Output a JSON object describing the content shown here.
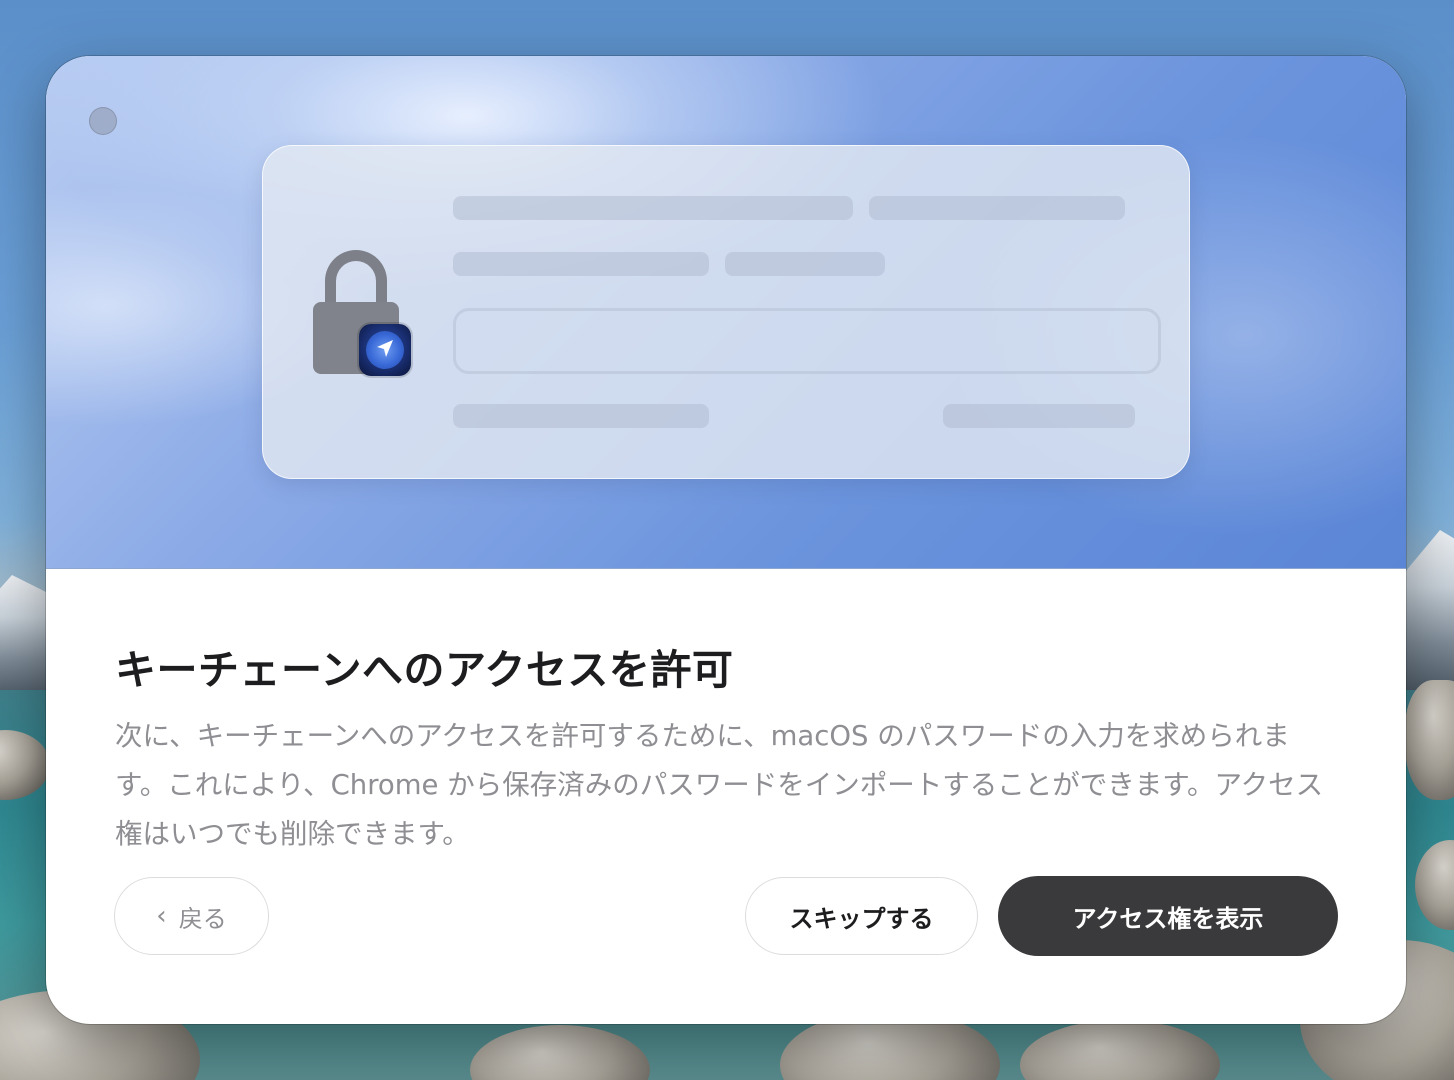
{
  "dialog": {
    "title": "キーチェーンへのアクセスを許可",
    "description": "次に、キーチェーンへのアクセスを許可するために、macOS のパスワードの入力を求められます。これにより、Chrome から保存済みのパスワードをインポートすることができます。アクセス権はいつでも削除できます。",
    "buttons": {
      "back_label": "戻る",
      "skip_label": "スキップする",
      "primary_label": "アクセス権を表示"
    }
  },
  "icons": {
    "window_close": "close-dot-icon",
    "lock": "lock-icon",
    "app_badge": "app-badge-icon",
    "back": "chevron-left-icon"
  },
  "colors": {
    "primary_button": "#3a3a3c",
    "hero_blue": "#6b94dd",
    "description_text": "#8e8e93"
  }
}
